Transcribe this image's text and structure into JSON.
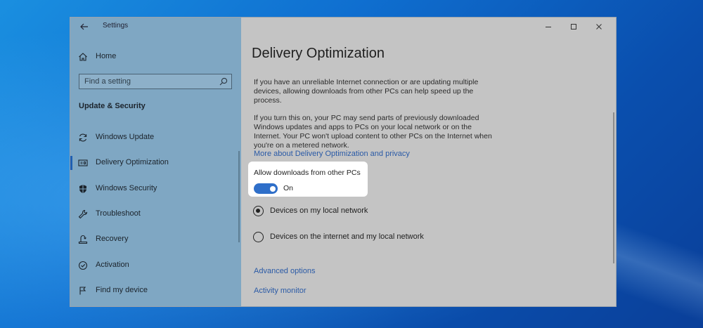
{
  "window": {
    "title": "Settings"
  },
  "sidebar": {
    "home_label": "Home",
    "search_placeholder": "Find a setting",
    "section_title": "Update & Security",
    "items": [
      {
        "label": "Windows Update",
        "icon": "refresh-icon"
      },
      {
        "label": "Delivery Optimization",
        "icon": "delivery-icon",
        "active": true
      },
      {
        "label": "Windows Security",
        "icon": "shield-icon"
      },
      {
        "label": "Troubleshoot",
        "icon": "wrench-icon"
      },
      {
        "label": "Recovery",
        "icon": "recovery-icon"
      },
      {
        "label": "Activation",
        "icon": "activation-icon"
      },
      {
        "label": "Find my device",
        "icon": "find-device-icon"
      }
    ]
  },
  "main": {
    "title": "Delivery Optimization",
    "para1": "If you have an unreliable Internet connection or are updating multiple devices, allowing downloads from other PCs can help speed up the process.",
    "para2": "If you turn this on, your PC may send parts of previously downloaded Windows updates and apps to PCs on your local network or on the Internet. Your PC won't upload content to other PCs on the Internet when you're on a metered network.",
    "more_link": "More about Delivery Optimization and privacy",
    "toggle_label": "Allow downloads from other PCs",
    "toggle_state": "On",
    "radio_options": [
      {
        "label": "Devices on my local network",
        "checked": true
      },
      {
        "label": "Devices on the internet and my local network",
        "checked": false
      }
    ],
    "advanced_link": "Advanced options",
    "monitor_link": "Activity monitor"
  },
  "colors": {
    "sidebar_bg": "#7fa7c3",
    "content_bg": "#c4c4c4",
    "accent": "#2f6fc9",
    "link": "#2a5aa6"
  }
}
